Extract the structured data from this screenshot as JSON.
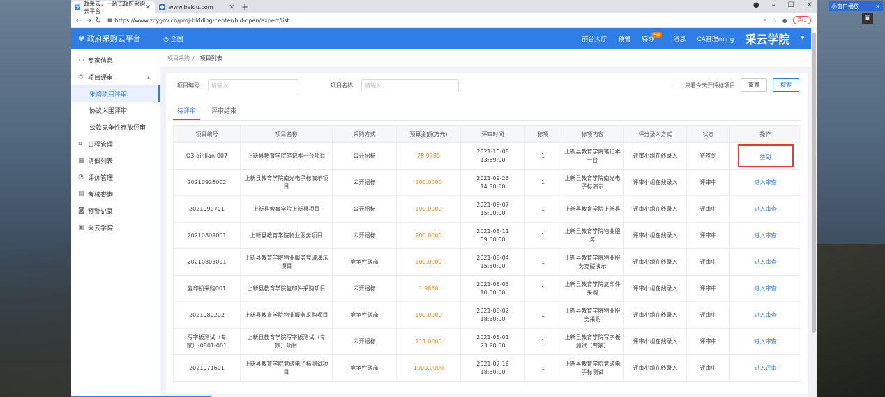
{
  "browser": {
    "tabs": [
      {
        "label": "政采云，一站式政府采购云平台",
        "active": true
      },
      {
        "label": "www.baidu.com",
        "active": false
      }
    ],
    "new_tab": "+",
    "url": "https://www.zcygov.cn/proj-bidding-center/bid-open/expert/list",
    "badge_text": "吾(.."
  },
  "app": {
    "logo": "政府采购云平台",
    "region": "全国",
    "nav": [
      "前台大厅",
      "预警",
      "待办",
      "消息"
    ],
    "todo_count": "94",
    "watermark": "采云学院",
    "user": "CA管理ming"
  },
  "sidebar": {
    "items": [
      {
        "label": "专家信息",
        "icon": "document-icon"
      },
      {
        "label": "项目评审",
        "icon": "shield-icon",
        "expanded": true
      },
      {
        "label": "采购项目评审",
        "sub": true,
        "active": true
      },
      {
        "label": "协议入围评审",
        "sub": true
      },
      {
        "label": "公款竞争性存放评审",
        "sub": true
      },
      {
        "label": "日程管理",
        "icon": "home-icon"
      },
      {
        "label": "请假列表",
        "icon": "calendar-icon"
      },
      {
        "label": "评价管理",
        "icon": "chart-icon"
      },
      {
        "label": "考核查询",
        "icon": "file-icon"
      },
      {
        "label": "预警记录",
        "icon": "bell-icon"
      },
      {
        "label": "采云学院",
        "icon": "book-icon"
      }
    ]
  },
  "breadcrumb": {
    "root": "项目采购",
    "sep": "/",
    "current": "项目列表"
  },
  "search": {
    "code_label": "项目编号：",
    "code_placeholder": "请输入",
    "name_label": "项目名称：",
    "name_placeholder": "请输入",
    "today_only": "只看今天开评标项目",
    "reset": "重置",
    "search": "搜索"
  },
  "tabs": [
    "待评审",
    "评审结束"
  ],
  "table": {
    "headers": [
      "项目编号",
      "项目名称",
      "采购方式",
      "预算金额(万元)",
      "评审时间",
      "标项",
      "标项内容",
      "评分录入方式",
      "状态",
      "操作"
    ],
    "rows": [
      [
        "Q3-qinlian-007",
        "上新县教育学院笔记本一台项目",
        "公开招标",
        "78.9789",
        "2021-10-08 13:59:00",
        "1",
        "上新县教育学院笔记本一台",
        "评审小组在线录入",
        "待签到",
        "签到"
      ],
      [
        "20210926002",
        "上新县教育学院南光电子标演示项目",
        "公开招标",
        "200.0000",
        "2021-09-26 14:30:00",
        "1",
        "上新县教育学院南光电子标演示",
        "评审小组在线录入",
        "评审中",
        "进入审查"
      ],
      [
        "2021090701",
        "上新县教育学院上新县项目",
        "公开招标",
        "100.0000",
        "2021-09-07 15:00:00",
        "1",
        "上新县教育学院上新县",
        "评审小组在线录入",
        "评审中",
        "进入审查"
      ],
      [
        "20210809001",
        "上新县教育学院物业服务项目",
        "公开招标",
        "200.0000",
        "2021-08-11 09:00:00",
        "1",
        "上新县教育学院物业服务",
        "评审小组在线录入",
        "评审中",
        "进入审查"
      ],
      [
        "20210803001",
        "上新县教育学院物业服务竞磋演示项目",
        "竞争性磋商",
        "100.0000",
        "2021-08-04 15:30:00",
        "1",
        "上新县教育学院物业服务竞磋演示",
        "评审小组在线录入",
        "评审中",
        "进入审查"
      ],
      [
        "复印机采购001",
        "上新县教育学院复印件采购项目",
        "公开招标",
        "1.9880",
        "2021-08-03 10:00:00",
        "1",
        "上新县教育学院复印件采购",
        "评审小组在线录入",
        "评审中",
        "进入审查"
      ],
      [
        "2021080202",
        "上新县教育学院物业服务采购项目",
        "竞争性磋商",
        "100.0000",
        "2021-08-02 18:30:00",
        "1",
        "上新县教育学院物业服务采购",
        "评审小组在线录入",
        "评审中",
        "进入审查"
      ],
      [
        "写字板测试（专家）-0801-001",
        "上新县教育学院写字板测试（专家）项目",
        "公开招标",
        "111.0000",
        "2021-08-01 23:20:00",
        "1",
        "上新县教育学院写字板测试（专家）",
        "评审小组在线录入",
        "评审中",
        "进入审查"
      ],
      [
        "2021071601",
        "上新县教育学院竞磋电子标测试项目",
        "竞争性磋商",
        "1000.0000",
        "2021-07-16 18:50:00",
        "1",
        "上新县教育学院竞磋电子标测试",
        "评审小组在线录入",
        "评审中",
        "进入评审"
      ]
    ]
  },
  "desktop": {
    "mini_window": "小窗口播放"
  },
  "colors": {
    "primary": "#2f7ee8",
    "money": "#f08a22",
    "highlight": "#e53935"
  }
}
